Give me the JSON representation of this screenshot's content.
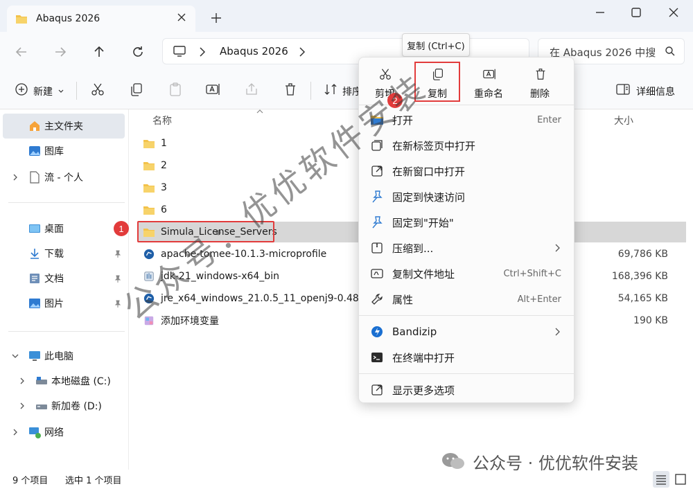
{
  "window": {
    "tab_title": "Abaqus 2026",
    "minimize": "—",
    "maximize": "☐",
    "close": "✕"
  },
  "address": {
    "path_item": "Abaqus 2026",
    "search_placeholder": "在 Abaqus 2026 中搜"
  },
  "toolbar": {
    "new_label": "新建",
    "sort_label": "排序",
    "details_label": "详细信息"
  },
  "sidebar": {
    "items": [
      {
        "label": "主文件夹",
        "icon": "home-icon"
      },
      {
        "label": "图库",
        "icon": "gallery-icon"
      },
      {
        "label": "流 - 个人",
        "icon": "cloud-icon"
      },
      {
        "label": "桌面",
        "icon": "desktop-icon"
      },
      {
        "label": "下载",
        "icon": "download-icon"
      },
      {
        "label": "文档",
        "icon": "document-icon"
      },
      {
        "label": "图片",
        "icon": "pictures-icon"
      },
      {
        "label": "此电脑",
        "icon": "computer-icon"
      },
      {
        "label": "本地磁盘 (C:)",
        "icon": "drive-icon"
      },
      {
        "label": "新加卷 (D:)",
        "icon": "drive-icon"
      },
      {
        "label": "网络",
        "icon": "network-icon"
      }
    ]
  },
  "files": {
    "col_name": "名称",
    "col_size": "大小",
    "rows": [
      {
        "name": "1",
        "size": "",
        "type": "folder"
      },
      {
        "name": "2",
        "size": "",
        "type": "folder"
      },
      {
        "name": "3",
        "size": "",
        "type": "folder"
      },
      {
        "name": "6",
        "size": "",
        "type": "folder"
      },
      {
        "name": "Simula_License_Servers",
        "size": "",
        "type": "folder"
      },
      {
        "name": "apache-tomee-10.1.3-microprofile",
        "size": "69,786 KB",
        "type": "archive"
      },
      {
        "name": "jdk-21_windows-x64_bin",
        "size": "168,396 KB",
        "type": "installer"
      },
      {
        "name": "jre_x64_windows_21.0.5_11_openj9-0.48.0",
        "size": "54,165 KB",
        "type": "archive"
      },
      {
        "name": "添加环境变量",
        "size": "190 KB",
        "type": "app"
      }
    ]
  },
  "status": {
    "count": "9 个项目",
    "selected": "选中 1 个项目"
  },
  "context_menu": {
    "tooltip": "复制 (Ctrl+C)",
    "quick": {
      "cut": "剪切",
      "copy": "复制",
      "rename": "重命名",
      "delete": "删除"
    },
    "items": [
      {
        "label": "打开",
        "shortcut": "Enter"
      },
      {
        "label": "在新标签页中打开",
        "shortcut": ""
      },
      {
        "label": "在新窗口中打开",
        "shortcut": ""
      },
      {
        "label": "固定到快速访问",
        "shortcut": ""
      },
      {
        "label": "固定到\"开始\"",
        "shortcut": ""
      },
      {
        "label": "压缩到...",
        "shortcut": ""
      },
      {
        "label": "复制文件地址",
        "shortcut": "Ctrl+Shift+C"
      },
      {
        "label": "属性",
        "shortcut": "Alt+Enter"
      },
      {
        "label": "Bandizip",
        "shortcut": ""
      },
      {
        "label": "在终端中打开",
        "shortcut": ""
      },
      {
        "label": "显示更多选项",
        "shortcut": ""
      }
    ]
  },
  "annotations": {
    "badge1": "1",
    "badge2": "2"
  },
  "watermark": {
    "diagonal": "公众号：优优软件安装",
    "bottom": "公众号 · 优优软件安装"
  },
  "colors": {
    "accent": "#0067c0",
    "folder": "#f3c24a",
    "highlight_red": "#e23b3b"
  }
}
